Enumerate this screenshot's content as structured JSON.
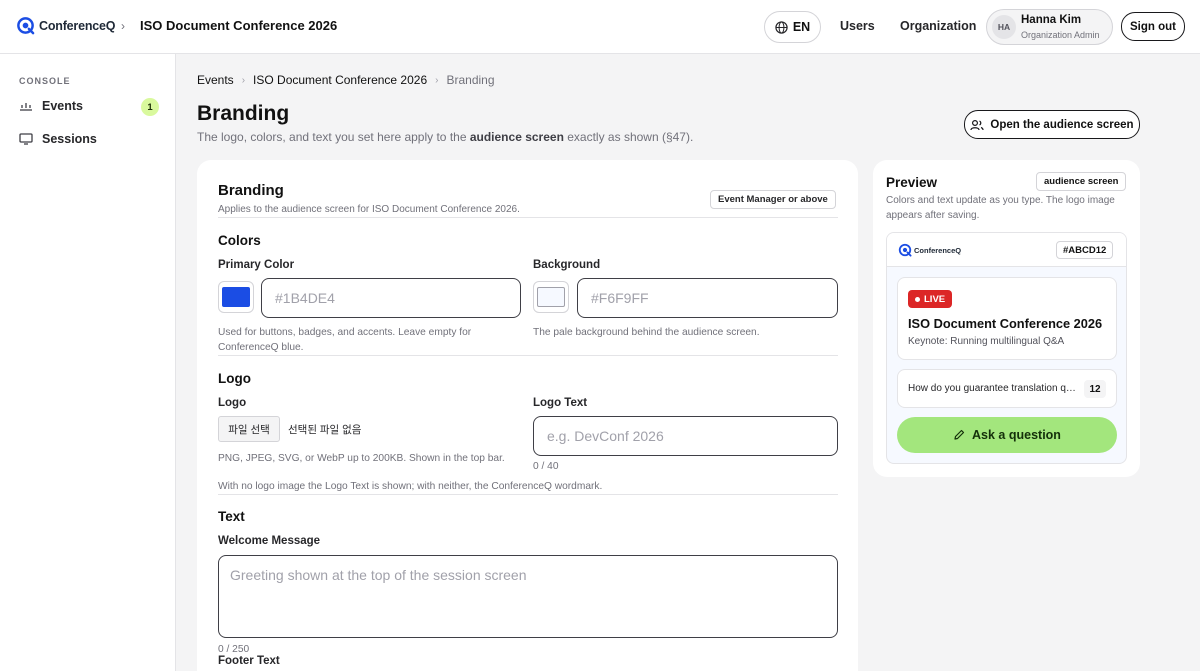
{
  "app": {
    "brand_name": "ConferenceQ",
    "event_title": "ISO Document Conference 2026"
  },
  "topbar": {
    "language": "EN",
    "nav_users": "Users",
    "nav_organization": "Organization",
    "user_initials": "HA",
    "user_name": "Hanna Kim",
    "user_role": "Organization Admin",
    "sign_out": "Sign out"
  },
  "sidebar": {
    "section_label": "CONSOLE",
    "items": [
      {
        "label": "Events",
        "badge": "1"
      },
      {
        "label": "Sessions"
      }
    ]
  },
  "breadcrumb": [
    "Events",
    "ISO Document Conference 2026",
    "Branding"
  ],
  "header": {
    "title": "Branding",
    "desc_prefix": "The logo, colors, and text you set here apply to the",
    "desc_bold": "audience screen",
    "desc_suffix": "exactly as shown (§47).",
    "open_button": "Open the audience screen"
  },
  "form": {
    "title": "Branding",
    "subtitle": "Applies to the audience screen for ISO Document Conference 2026.",
    "role_chip": "Event Manager or above",
    "colors": {
      "section": "Colors",
      "primary_label": "Primary Color",
      "primary_placeholder": "#1B4DE4",
      "primary_swatch": "#1B4DE4",
      "primary_help": "Used for buttons, badges, and accents. Leave empty for ConferenceQ blue.",
      "background_label": "Background",
      "background_placeholder": "#F6F9FF",
      "background_swatch": "#F6F9FF",
      "background_help": "The pale background behind the audience screen."
    },
    "logo": {
      "section": "Logo",
      "logo_label": "Logo",
      "file_button": "파일 선택",
      "file_status": "선택된 파일 없음",
      "logo_help": "PNG, JPEG, SVG, or WebP up to 200KB. Shown in the top bar.",
      "logo_text_label": "Logo Text",
      "logo_text_placeholder": "e.g. DevConf 2026",
      "logo_text_count": "0 / 40",
      "fallback_help": "With no logo image the Logo Text is shown; with neither, the ConferenceQ wordmark."
    },
    "text": {
      "section": "Text",
      "welcome_label": "Welcome Message",
      "welcome_placeholder": "Greeting shown at the top of the session screen",
      "welcome_count": "0 / 250",
      "footer_label": "Footer Text"
    }
  },
  "preview": {
    "title": "Preview",
    "chip": "audience screen",
    "desc": "Colors and text update as you type. The logo image appears after saving.",
    "brand_name": "ConferenceQ",
    "code": "#ABCD12",
    "live": "LIVE",
    "event_name": "ISO Document Conference 2026",
    "session": "Keynote: Running multilingual Q&A",
    "question": "How do you guarantee translation quality?",
    "question_count": "12",
    "ask_button": "Ask a question"
  },
  "colors": {
    "accent": "#1B4DE4",
    "live": "#DC2626",
    "ask_button": "#A3E67D",
    "badge": "#D9F99D"
  }
}
